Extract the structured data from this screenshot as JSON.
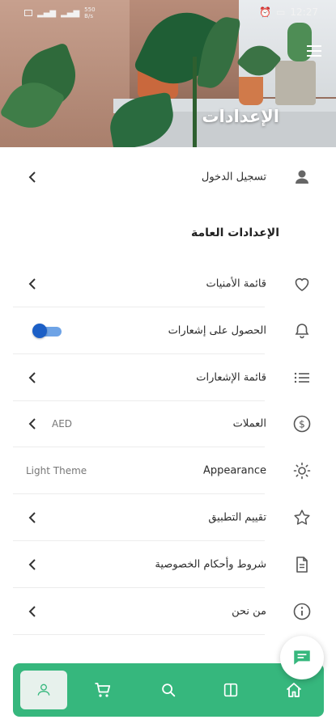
{
  "status_bar": {
    "left_speed": "550\nB/s",
    "time": "12:27"
  },
  "header": {
    "title": "الإعدادات"
  },
  "login": {
    "label": "تسجيل الدخول"
  },
  "general": {
    "section_title": "الإعدادات العامة",
    "items": [
      {
        "label": "قائمة الأمنيات",
        "icon": "heart-icon"
      },
      {
        "label": "الحصول على إشعارات",
        "icon": "bell-icon",
        "toggle_on": true
      },
      {
        "label": "قائمة الإشعارات",
        "icon": "list-icon"
      },
      {
        "label": "العملات",
        "icon": "dollar-circle-icon",
        "value": "AED"
      },
      {
        "label": "Appearance",
        "icon": "sun-icon",
        "value": "Light Theme"
      },
      {
        "label": "تقييم التطبيق",
        "icon": "star-icon"
      },
      {
        "label": "شروط وأحكام الخصوصية",
        "icon": "document-icon"
      },
      {
        "label": "من نحن",
        "icon": "info-icon"
      }
    ]
  },
  "bottom_nav": {
    "items": [
      "profile-icon",
      "cart-icon",
      "search-icon",
      "book-icon",
      "home-icon"
    ],
    "active": "profile-icon"
  },
  "colors": {
    "accent": "#36b77d",
    "toggle": "#1c5fc6"
  }
}
